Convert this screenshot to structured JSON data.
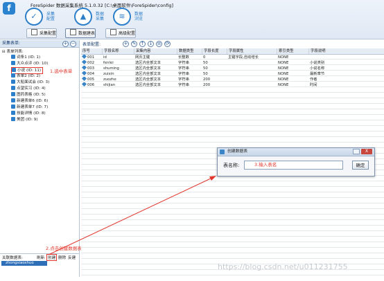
{
  "app": {
    "logo": "f",
    "title": "ForeSpider 数据采集系统  5.1.0.32  [C:\\桌面软件\\ForeSpider\\config]"
  },
  "nav": [
    {
      "label": "采集\n配置",
      "icon": "crawl-config-icon"
    },
    {
      "label": "数据\n采集",
      "icon": "data-collect-icon"
    },
    {
      "label": "数据\n浏览",
      "icon": "data-browse-icon"
    }
  ],
  "subnav": [
    "采集配置",
    "数据建表",
    "高级配置"
  ],
  "left": {
    "header": "采集表单:",
    "root": "表单列表:",
    "items": [
      "词条1 (ID: 1)",
      "大众点评 (ID: 10)",
      "小说 (ID: 11)",
      "表单2 (ID: 2)",
      "大船面试会 (ID: 3)",
      "点望实习 (ID: 4)",
      "图药表格 (ID: 5)",
      "新建表单6 (ID: 6)",
      "新建表单7 (ID: 7)",
      "技能详情 (ID: 8)",
      "美团 (ID: 9)"
    ],
    "annotation1": "1.选中表单"
  },
  "bottom": {
    "header": "关联数据表:",
    "buttons": [
      "刷新",
      "创建",
      "删除",
      "反建"
    ],
    "list_item": "zhongxiaoshuo",
    "annotation2": "2.点击创建数据表"
  },
  "right": {
    "header": "表单配置:",
    "columns": [
      "序号",
      "字段名称",
      "采集内容",
      "数据类型",
      "字段长度",
      "字段属性",
      "索引类型",
      "字段说明"
    ],
    "rows": [
      [
        "001",
        "id",
        "网页主键",
        "长整数",
        "0",
        "主键字段,自动增长",
        "NONE",
        ""
      ],
      [
        "002",
        "fenlei",
        "选区内全部文本",
        "字符串",
        "50",
        "",
        "NONE",
        "小说类别"
      ],
      [
        "003",
        "shuming",
        "选区内全部文本",
        "字符串",
        "50",
        "",
        "NONE",
        "小说名称"
      ],
      [
        "004",
        "zuixin",
        "选区内全部文本",
        "字符串",
        "50",
        "",
        "NONE",
        "最新章节"
      ],
      [
        "005",
        "zuozhe",
        "选区内全部文本",
        "字符串",
        "200",
        "",
        "NONE",
        "作者"
      ],
      [
        "006",
        "shijian",
        "选区内全部文本",
        "字符串",
        "200",
        "",
        "NONE",
        "时间"
      ]
    ]
  },
  "dialog": {
    "title": "创建数据表",
    "label": "表名称:",
    "input_value": "3.输入表名",
    "ok": "确定",
    "close": "X"
  },
  "watermark": "https://blog.csdn.net/u011231755",
  "colors": {
    "accent": "#2d7fc9",
    "annotation": "#e2352b"
  }
}
